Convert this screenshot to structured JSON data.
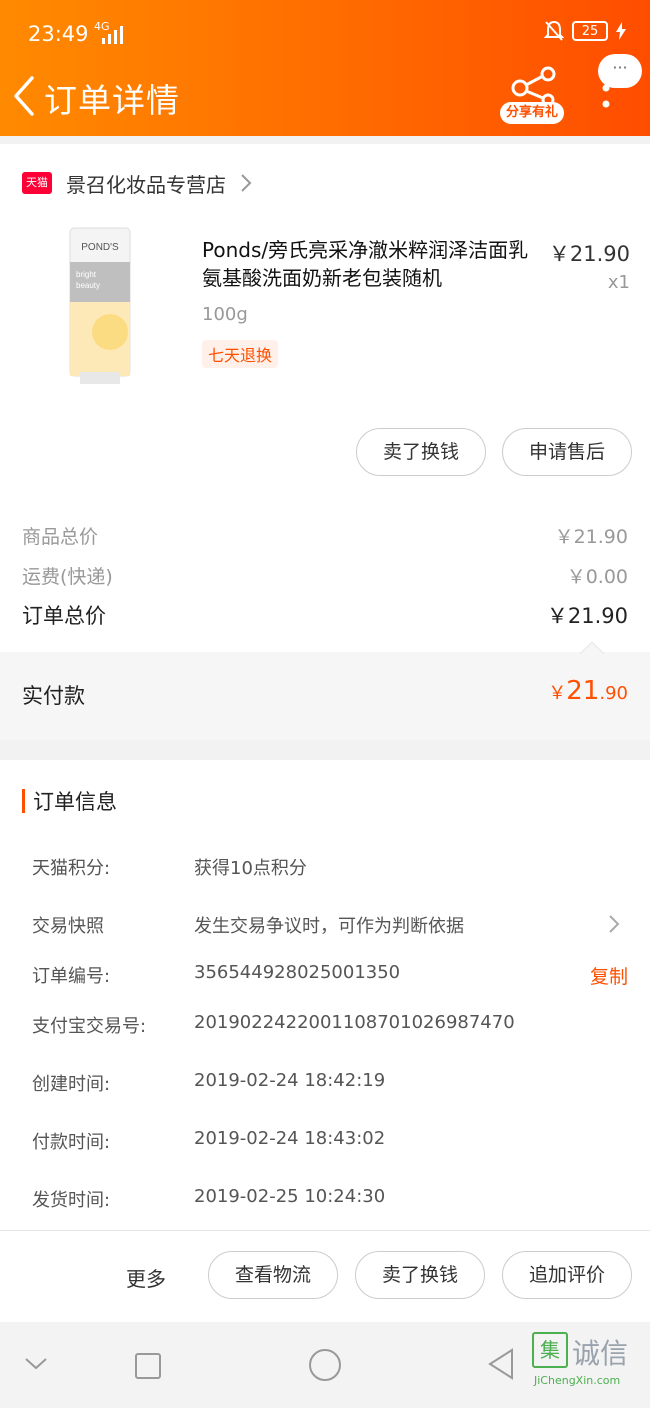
{
  "status_bar": {
    "time": "23:49",
    "network": "4G",
    "battery": "25"
  },
  "header": {
    "title": "订单详情",
    "share_label": "分享有礼",
    "more_label": "···"
  },
  "shop": {
    "badge": "天猫",
    "name": "景召化妆品专营店"
  },
  "product": {
    "title": "Ponds/旁氏亮采净澈米粹润泽洁面乳氨基酸洗面奶新老包装随机",
    "price": "￥21.90",
    "qty": "x1",
    "spec": "100g",
    "tag": "七天退换",
    "image_brand": "POND'S",
    "image_line1": "bright",
    "image_line2": "beauty"
  },
  "card_actions": {
    "sell": "卖了换钱",
    "aftersale": "申请售后"
  },
  "prices": {
    "goods_label": "商品总价",
    "goods_value": "￥21.90",
    "shipping_label": "运费(快递)",
    "shipping_value": "￥0.00",
    "total_label": "订单总价",
    "total_value": "￥21.90",
    "paid_label": "实付款",
    "paid_currency": "￥",
    "paid_int": "21",
    "paid_dec": ".90"
  },
  "order_info": {
    "title": "订单信息",
    "rows": [
      {
        "label": "天猫积分:",
        "value": "获得10点积分"
      },
      {
        "label": "交易快照",
        "value": "发生交易争议时，可作为判断依据"
      },
      {
        "label": "订单编号:",
        "value": "356544928025001350",
        "action": "复制"
      },
      {
        "label": "支付宝交易号:",
        "value": "2019022422001108701026987470"
      },
      {
        "label": "创建时间:",
        "value": "2019-02-24 18:42:19"
      },
      {
        "label": "付款时间:",
        "value": "2019-02-24 18:43:02"
      },
      {
        "label": "发货时间:",
        "value": "2019-02-25 10:24:30"
      }
    ]
  },
  "bottom_actions": {
    "more": "更多",
    "logistics": "查看物流",
    "sell": "卖了换钱",
    "review": "追加评价"
  },
  "watermark": {
    "logo": "集",
    "text": "诚信",
    "url": "JiChengXin.com"
  },
  "colors": {
    "header_from": "#ff8a00",
    "header_to": "#ff4d00",
    "accent": "#ff5000",
    "tmall_red": "#ff0036"
  }
}
